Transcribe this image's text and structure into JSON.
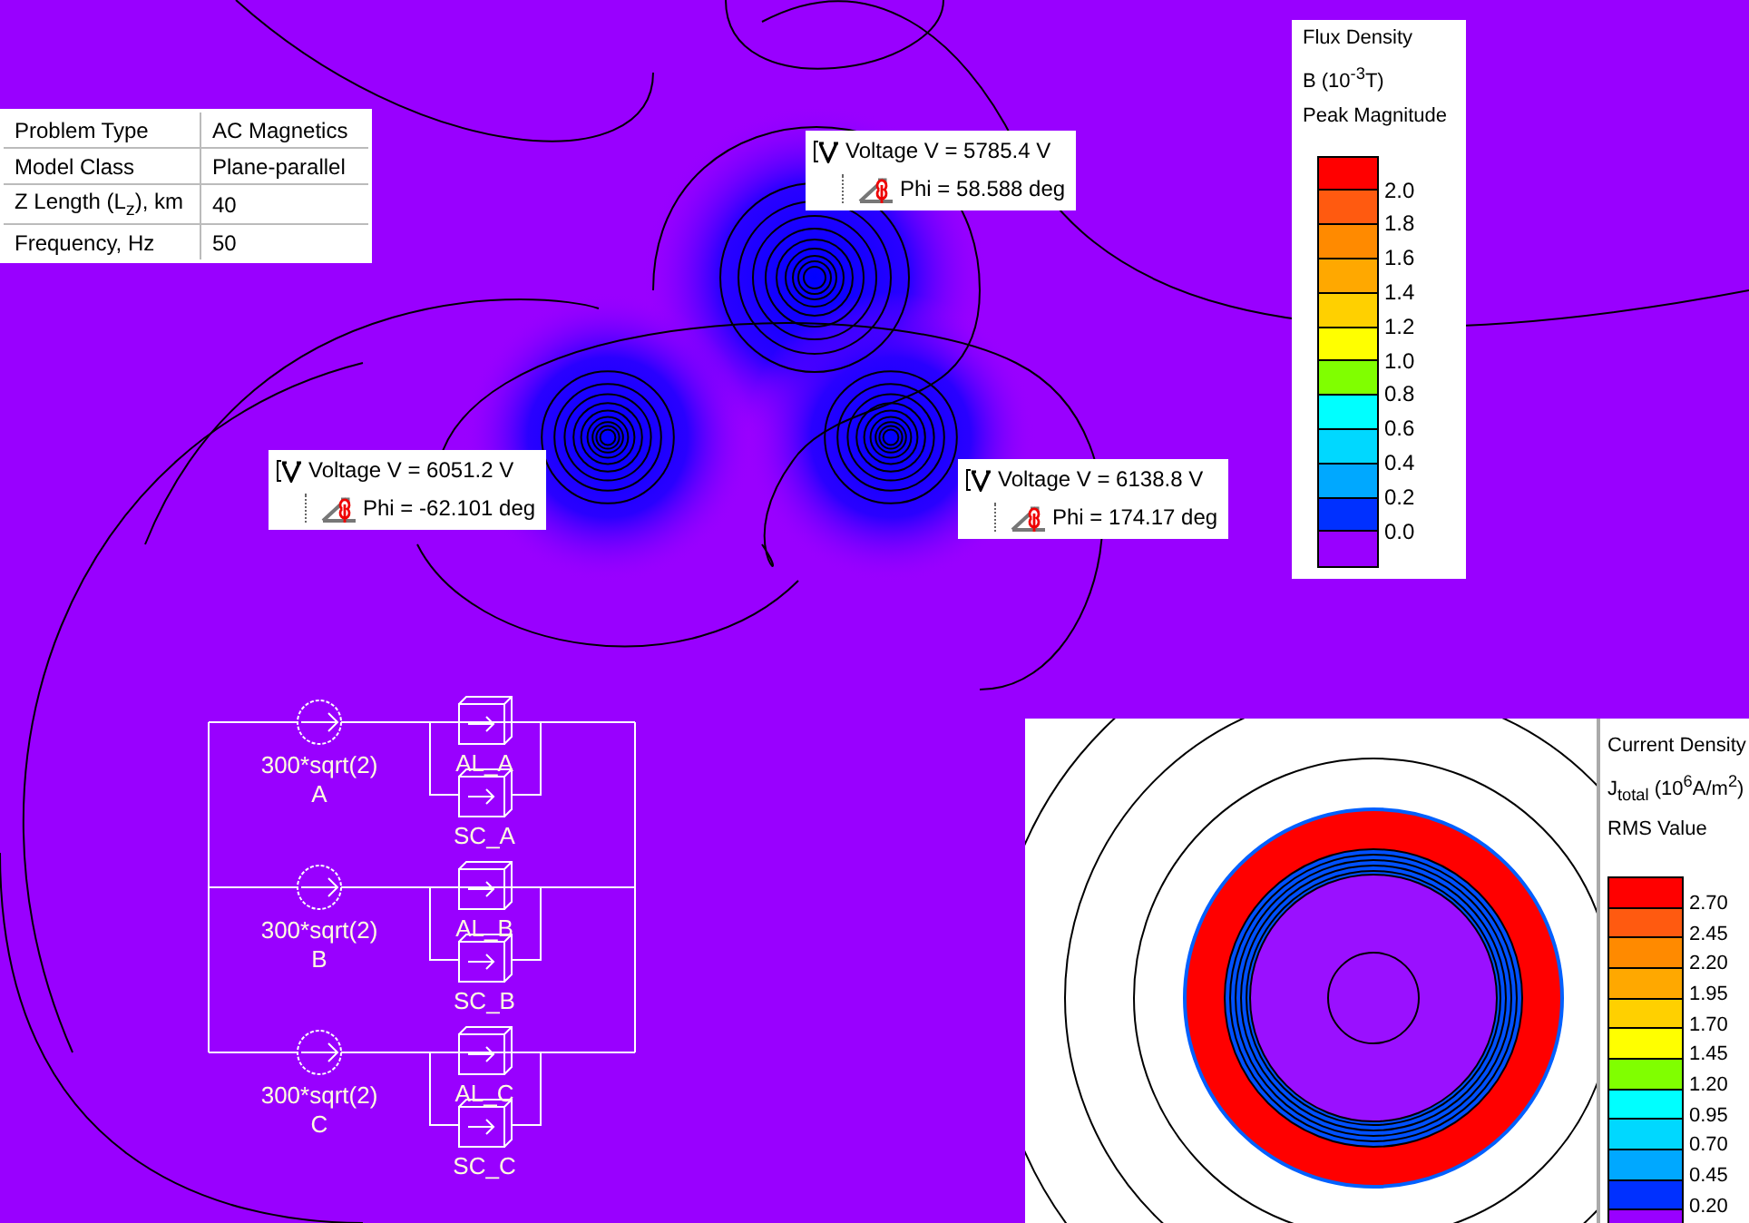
{
  "problem_table": {
    "rows": [
      {
        "label": "Problem Type",
        "value": "AC Magnetics"
      },
      {
        "label": "Model Class",
        "value": "Plane-parallel"
      },
      {
        "label": "Z Length (L$_{z}$), km",
        "value": "40"
      },
      {
        "label": "Frequency, Hz",
        "value": "50"
      }
    ]
  },
  "callouts": [
    {
      "voltage": "Voltage V = 5785.4 V",
      "phase": "Phi = 58.588 deg"
    },
    {
      "voltage": "Voltage V = 6051.2 V",
      "phase": "Phi = -62.101 deg"
    },
    {
      "voltage": "Voltage V = 6138.8 V",
      "phase": "Phi = 174.17 deg"
    }
  ],
  "flux_legend": {
    "title": "Flux Density",
    "unit": "B (10$^{-3}$T)",
    "quantity": "Peak Magnitude",
    "ticks": [
      "2.0",
      "1.8",
      "1.6",
      "1.4",
      "1.2",
      "1.0",
      "0.8",
      "0.6",
      "0.4",
      "0.2",
      "0.0"
    ]
  },
  "circuit": {
    "sources": [
      {
        "value": "300*sqrt(2)",
        "name": "A",
        "conductors": [
          "AL_A",
          "SC_A"
        ]
      },
      {
        "value": "300*sqrt(2)",
        "name": "B",
        "conductors": [
          "AL_B",
          "SC_B"
        ]
      },
      {
        "value": "300*sqrt(2)",
        "name": "C",
        "conductors": [
          "AL_C",
          "SC_C"
        ]
      }
    ]
  },
  "current_legend": {
    "title": "Current Density",
    "unit": "J$_{total}$ (10$^{6}$A/m$^{2}$)",
    "quantity": "RMS Value",
    "ticks": [
      "2.70",
      "2.45",
      "2.20",
      "1.95",
      "1.70",
      "1.45",
      "1.20",
      "0.95",
      "0.70",
      "0.45",
      "0.20"
    ]
  }
}
